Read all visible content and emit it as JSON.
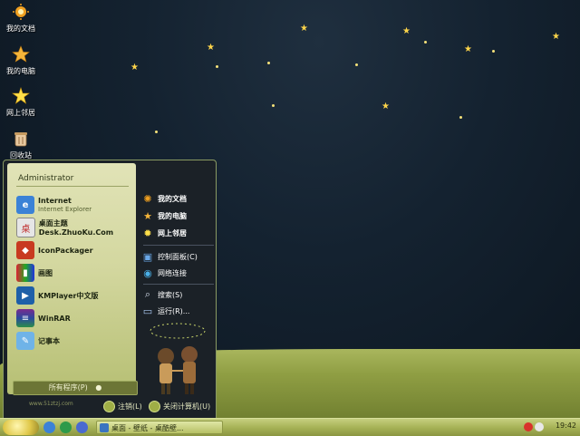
{
  "desktop": {
    "icons": [
      {
        "label": "我的文档",
        "icon": "my-documents-icon"
      },
      {
        "label": "我的电脑",
        "icon": "my-computer-icon"
      },
      {
        "label": "网上邻居",
        "icon": "network-icon"
      },
      {
        "label": "回收站",
        "icon": "recycle-bin-icon"
      }
    ]
  },
  "start_menu": {
    "user": "Administrator",
    "programs": [
      {
        "title": "Internet",
        "subtitle": "Internet Explorer",
        "icon": "internet-explorer-icon"
      },
      {
        "title": "桌面主题Desk.ZhuoKu.Com",
        "subtitle": "",
        "icon": "theme-icon"
      },
      {
        "title": "IconPackager",
        "subtitle": "",
        "icon": "iconpackager-icon"
      },
      {
        "title": "画图",
        "subtitle": "",
        "icon": "paint-icon"
      },
      {
        "title": "KMPlayer中文版",
        "subtitle": "",
        "icon": "kmplayer-icon"
      },
      {
        "title": "WinRAR",
        "subtitle": "",
        "icon": "winrar-icon"
      },
      {
        "title": "记事本",
        "subtitle": "",
        "icon": "notepad-icon"
      }
    ],
    "all_programs": "所有程序(P)",
    "site": "www.51ztzj.com",
    "right_items": [
      {
        "label": "我的文档",
        "icon": "my-documents-icon"
      },
      {
        "label": "我的电脑",
        "icon": "my-computer-icon"
      },
      {
        "label": "网上邻居",
        "icon": "network-icon"
      },
      {
        "label": "控制面板(C)",
        "icon": "control-panel-icon"
      },
      {
        "label": "网络连接",
        "icon": "network-connections-icon"
      },
      {
        "label": "搜索(S)",
        "icon": "search-icon"
      },
      {
        "label": "运行(R)...",
        "icon": "run-icon"
      }
    ],
    "logoff": "注销(L)",
    "shutdown": "关闭计算机(U)"
  },
  "taskbar": {
    "task_label": "桌面 - 壁纸 - 桌酷壁...",
    "clock": "19:42"
  },
  "colors": {
    "sky": "#0e1620",
    "field": "#9aa84d",
    "taskbar": "#a7b357",
    "star": "#ffd54a"
  }
}
